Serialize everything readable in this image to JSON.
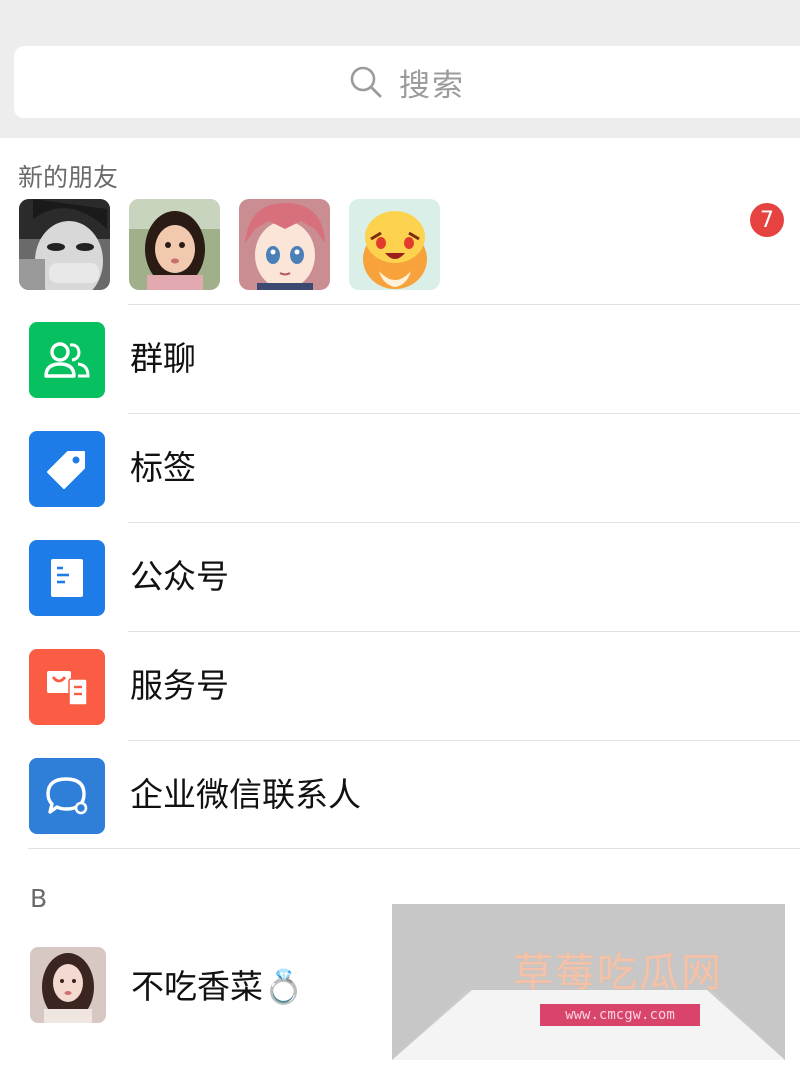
{
  "search": {
    "placeholder": "搜索",
    "icon": "search-icon"
  },
  "new_friends": {
    "title": "新的朋友",
    "badge_count": "7",
    "badge_color": "#e64340"
  },
  "menu": [
    {
      "label": "群聊",
      "icon": "group-chat-icon",
      "color": "#07c160"
    },
    {
      "label": "标签",
      "icon": "tag-icon",
      "color": "#1e7ce8"
    },
    {
      "label": "公众号",
      "icon": "official-account-icon",
      "color": "#1e7ce8"
    },
    {
      "label": "服务号",
      "icon": "service-account-icon",
      "color": "#fa5d43"
    },
    {
      "label": "企业微信联系人",
      "icon": "wecom-contact-icon",
      "color": "#2f7fd9"
    }
  ],
  "contacts": {
    "section_letter": "B",
    "items": [
      {
        "name": "不吃香菜💍"
      }
    ]
  },
  "watermark": {
    "title": "草莓吃瓜网",
    "url": "www.cmcgw.com"
  }
}
